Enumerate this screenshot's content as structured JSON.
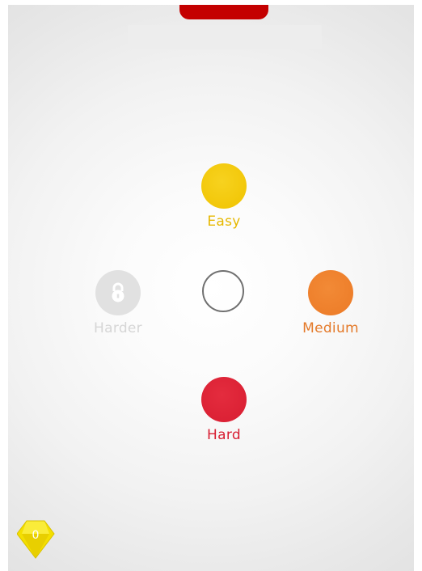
{
  "modes": {
    "easy": {
      "label": "Easy",
      "color": "#f0c300",
      "locked": false
    },
    "medium": {
      "label": "Medium",
      "color": "#ec7a26",
      "locked": false
    },
    "hard": {
      "label": "Hard",
      "color": "#d81d31",
      "locked": false
    },
    "harder": {
      "label": "Harder",
      "color": "#e1e1e1",
      "locked": true,
      "icon": "lock-icon"
    }
  },
  "gems": {
    "count": "0",
    "icon": "diamond-gem-icon",
    "color": "#f5e000"
  },
  "header": {
    "tab_color": "#c40000"
  }
}
